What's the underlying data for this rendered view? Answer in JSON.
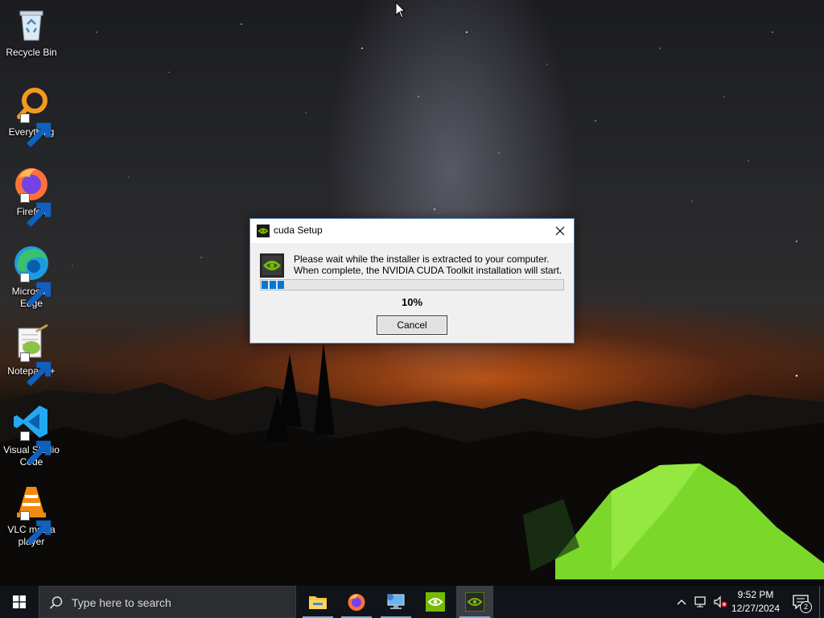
{
  "desktop": {
    "icons": [
      {
        "label": "Recycle Bin",
        "icon": "recycle-bin-icon"
      },
      {
        "label": "Everything",
        "icon": "everything-search-icon"
      },
      {
        "label": "Firefox",
        "icon": "firefox-icon"
      },
      {
        "label": "Microsoft Edge",
        "icon": "edge-icon"
      },
      {
        "label": "Notepad++",
        "icon": "notepad-plus-plus-icon"
      },
      {
        "label": "Visual Studio Code",
        "icon": "vscode-icon"
      },
      {
        "label": "VLC media player",
        "icon": "vlc-icon"
      }
    ]
  },
  "dialog": {
    "title": "cuda Setup",
    "message_line1": "Please wait while the installer is extracted to your computer.",
    "message_line2": "When complete, the NVIDIA CUDA Toolkit installation will start.",
    "progress_fraction": 0.1,
    "percent_label": "10%",
    "cancel_label": "Cancel",
    "close_glyph": "✕"
  },
  "taskbar": {
    "search_placeholder": "Type here to search",
    "apps": [
      {
        "name": "file-explorer",
        "active": false
      },
      {
        "name": "firefox",
        "active": false
      },
      {
        "name": "remote-desktop",
        "active": false
      },
      {
        "name": "nvidia",
        "active": false
      },
      {
        "name": "cuda-setup",
        "active": true
      }
    ],
    "time": "9:52 PM",
    "date": "12/27/2024",
    "notification_count": "2"
  },
  "colors": {
    "accent": "#0078d7",
    "nvidia_green": "#76b900",
    "taskbar": "#101418"
  }
}
